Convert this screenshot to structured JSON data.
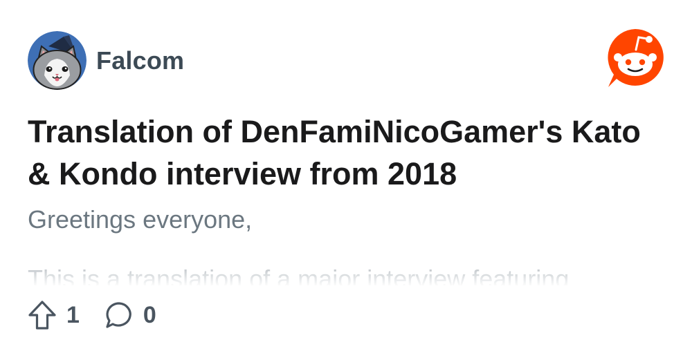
{
  "post": {
    "author": "Falcom",
    "title": "Translation of DenFamiNicoGamer's Kato & Kondo interview from 2018",
    "excerpt": {
      "line1": "Greetings everyone,",
      "line2": "This is a translation of a major interview featuring"
    }
  },
  "actions": {
    "upvote_count": "1",
    "comment_count": "0"
  },
  "icons": {
    "avatar": "cat-avatar-icon",
    "logo": "reddit-logo-icon",
    "upvote": "upvote-arrow-icon",
    "comment": "comment-bubble-icon"
  },
  "colors": {
    "brand": "#ff4500",
    "title": "#1a1a1b",
    "text_secondary": "#6b7780",
    "avatar_bg": "#3e6fb5"
  }
}
